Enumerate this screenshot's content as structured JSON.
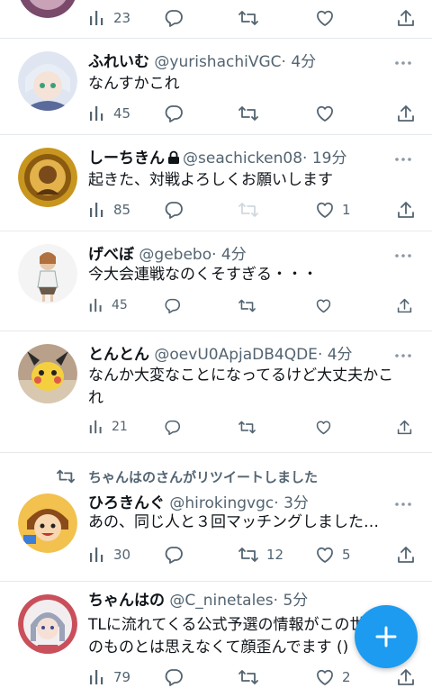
{
  "tweets": [
    {
      "id": "t0",
      "name": "",
      "handle": "",
      "time": "",
      "text": "",
      "views": "23",
      "replies": "",
      "retweets": "",
      "likes": ""
    },
    {
      "id": "t1",
      "name": "ふれいむ",
      "handle": "@yurishachiVGC",
      "time": "· 4分",
      "text": "なんすかこれ",
      "views": "45",
      "replies": "",
      "retweets": "",
      "likes": ""
    },
    {
      "id": "t2",
      "name": "しーちきん",
      "locked": true,
      "handle": "@seachicken08",
      "time": "· 19分",
      "text": "起きた、対戦よろしくお願いします",
      "views": "85",
      "replies": "",
      "retweets": "",
      "likes": "1"
    },
    {
      "id": "t3",
      "name": "げべぼ",
      "handle": "@gebebo",
      "time": "· 4分",
      "text": "今大会連戦なのくそすぎる・・・",
      "views": "45",
      "replies": "",
      "retweets": "",
      "likes": ""
    },
    {
      "id": "t4",
      "name": "とんとん",
      "handle": "@oevU0ApjaDB4QDE",
      "time": "· 4分",
      "text": "なんか大変なことになってるけど大丈夫かこれ",
      "views": "21",
      "replies": "",
      "retweets": "",
      "likes": ""
    },
    {
      "id": "t5",
      "retweeted_by": "ちゃんはのさんがリツイートしました",
      "name": "ひろきんぐ",
      "handle": "@hirokingvgc",
      "time": "· 3分",
      "text": "あの、同じ人と３回マッチングしました…",
      "views": "30",
      "replies": "",
      "retweets": "12",
      "likes": "5"
    },
    {
      "id": "t6",
      "name": "ちゃんはの",
      "handle": "@C_ninetales",
      "time": "· 5分",
      "text": "TLに流れてくる公式予選の情報がこの世のものとは思えなくて顔歪んでます ()",
      "views": "79",
      "replies": "",
      "retweets": "",
      "likes": "2"
    }
  ],
  "retweet_note": "ちゃんはのさんがリツイートしました",
  "compose_icon": "plus-icon",
  "colors": {
    "accent": "#1d9bf0",
    "muted": "#536471",
    "text": "#0f1419",
    "divider": "#e6e9ec"
  }
}
